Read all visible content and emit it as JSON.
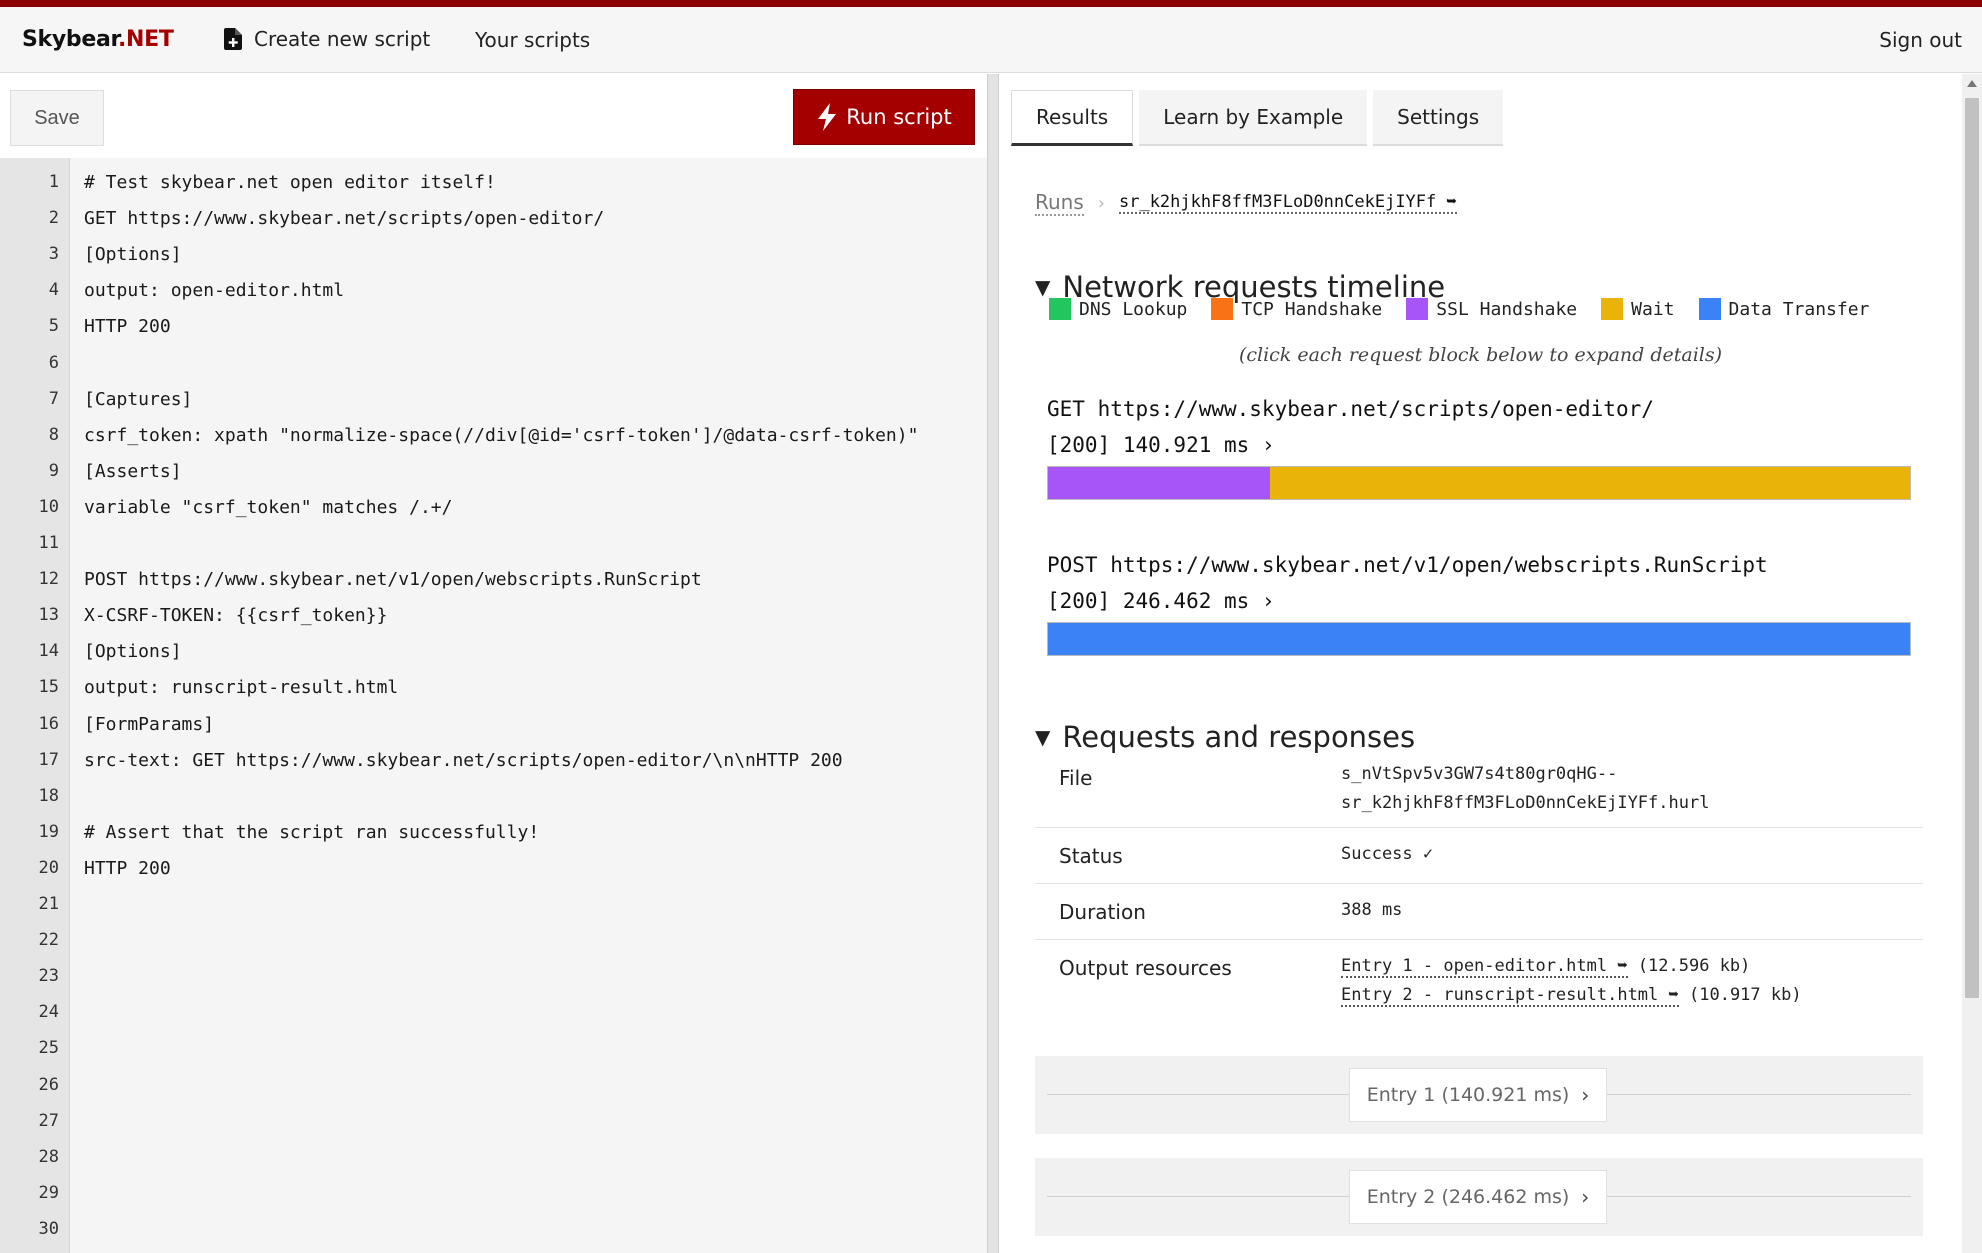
{
  "nav": {
    "brand_main": "Skybear",
    "brand_suffix": ".NET",
    "create_label": "Create new script",
    "scripts_label": "Your scripts",
    "signout_label": "Sign out"
  },
  "toolbar": {
    "save_label": "Save",
    "run_label": "Run script"
  },
  "editor": {
    "lines": [
      "# Test skybear.net open editor itself!",
      "GET https://www.skybear.net/scripts/open-editor/",
      "[Options]",
      "output: open-editor.html",
      "HTTP 200",
      "",
      "[Captures]",
      "csrf_token: xpath \"normalize-space(//div[@id='csrf-token']/@data-csrf-token)\"",
      "[Asserts]",
      "variable \"csrf_token\" matches /.+/",
      "",
      "POST https://www.skybear.net/v1/open/webscripts.RunScript",
      "X-CSRF-TOKEN: {{csrf_token}}",
      "[Options]",
      "output: runscript-result.html",
      "[FormParams]",
      "src-text: GET https://www.skybear.net/scripts/open-editor/\\n\\nHTTP 200",
      "",
      "# Assert that the script ran successfully!",
      "HTTP 200",
      "",
      "",
      "",
      "",
      "",
      "",
      "",
      "",
      "",
      ""
    ],
    "line_numbers": [
      "1",
      "2",
      "3",
      "4",
      "5",
      "6",
      "7",
      "8",
      "9",
      "10",
      "11",
      "12",
      "13",
      "14",
      "15",
      "16",
      "17",
      "18",
      "19",
      "20",
      "21",
      "22",
      "23",
      "24",
      "25",
      "26",
      "27",
      "28",
      "29",
      "30"
    ]
  },
  "tabs": [
    {
      "label": "Results",
      "active": true
    },
    {
      "label": "Learn by Example",
      "active": false
    },
    {
      "label": "Settings",
      "active": false
    }
  ],
  "breadcrumb": {
    "runs_label": "Runs",
    "run_id": "sr_k2hjkhF8ffM3FLoD0nnCekEjIYFf ➥"
  },
  "timeline": {
    "title": "Network requests timeline",
    "legend": [
      {
        "label": "DNS Lookup",
        "color": "#22c55e"
      },
      {
        "label": "TCP Handshake",
        "color": "#f97316"
      },
      {
        "label": "SSL Handshake",
        "color": "#a855f7"
      },
      {
        "label": "Wait",
        "color": "#eab308"
      },
      {
        "label": "Data Transfer",
        "color": "#3b82f6"
      }
    ],
    "hint": "(click each request block below to expand details)",
    "requests": [
      {
        "method_url": "GET https://www.skybear.net/scripts/open-editor/",
        "status_time": "[200] 140.921 ms ›",
        "segments": [
          {
            "phase": "SSL Handshake",
            "fraction": 0.257,
            "color": "#a855f7"
          },
          {
            "phase": "Wait",
            "fraction": 0.743,
            "color": "#eab308"
          }
        ]
      },
      {
        "method_url": "POST https://www.skybear.net/v1/open/webscripts.RunScript",
        "status_time": "[200] 246.462 ms ›",
        "segments": [
          {
            "phase": "Data Transfer",
            "fraction": 1.0,
            "color": "#3b82f6"
          }
        ]
      }
    ]
  },
  "requests_responses": {
    "title": "Requests and responses",
    "file_label": "File",
    "file_value_1": "s_nVtSpv5v3GW7s4t80gr0qHG--",
    "file_value_2": "sr_k2hjkhF8ffM3FLoD0nnCekEjIYFf.hurl",
    "status_label": "Status",
    "status_value": "Success ✓",
    "duration_label": "Duration",
    "duration_value": "388 ms",
    "output_label": "Output resources",
    "output_1_link": "Entry 1 - open-editor.html ➥",
    "output_1_size": " (12.596 kb)",
    "output_2_link": "Entry 2 - runscript-result.html ➥",
    "output_2_size": " (10.917 kb)"
  },
  "entries": [
    {
      "label": "Entry 1 (140.921 ms)"
    },
    {
      "label": "Entry 2 (246.462 ms)"
    }
  ],
  "colors": {
    "brand_red": "#a40000",
    "top_strip": "#8b0000"
  }
}
